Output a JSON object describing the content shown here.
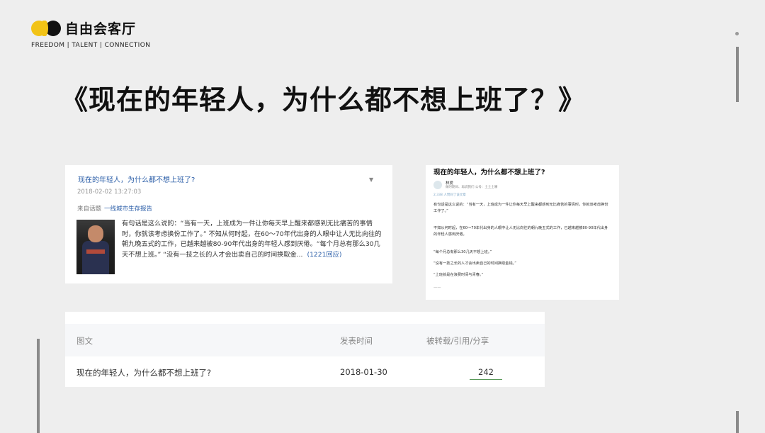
{
  "brand": {
    "name": "自由会客厅",
    "tagline": "FREEDOM | TALENT | CONNECTION"
  },
  "headline": "《现在的年轻人，为什么都不想上班了？》",
  "left_card": {
    "title": "现在的年轻人，为什么都不想上班了?",
    "date": "2018-02-02 13:27:03",
    "topic_prefix": "来自话题",
    "topic_link": "一线城市生存报告",
    "body": "有句话是这么说的：“当有一天，上班成为一件让你每天早上醒来都感到无比痛苦的事情时，你就该考虑换份工作了。” 不知从何时起，在60～70年代出身的人眼中让人无比向往的朝九晚五式的工作，已越来越被80-90年代出身的年轻人感到厌倦。“每个月总有那么30几天不想上班。” “没有一技之长的人才会出卖自己的时间换取金...",
    "reply": "(1221回应)"
  },
  "right_card": {
    "title": "现在的年轻人，为什么都不想上班了?",
    "author": "林爱",
    "meta": "做时期间、再说我们 公号：土土土嘴",
    "stat": "2,338 人赞同了该文章",
    "paragraphs": [
      "有句话是这么说的：“当有一天，上班成为一件让你每天早上醒来都感到无比痛苦的事情时，你就该考虑换份工作了。”",
      "不知从何时起，在60～70年代出身的人眼中让人无比向往的朝九晚五式的工作，已越来越被80-90年代出身的年轻人感到厌倦。",
      "“每个月总有那么30几天不想上班。”",
      "“没有一技之长的人才会出卖自己的时间换取金钱。”",
      "“上班就是在浪费时间与青春。”",
      "——"
    ]
  },
  "table": {
    "headers": [
      "图文",
      "发表时间",
      "被转载/引用/分享"
    ],
    "rows": [
      {
        "title": "现在的年轻人，为什么都不想上班了?",
        "date": "2018-01-30",
        "count": "242"
      }
    ]
  }
}
